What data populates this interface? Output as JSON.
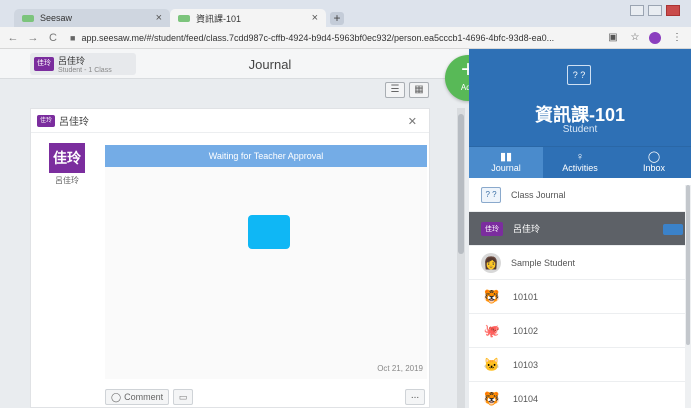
{
  "browser": {
    "tabs": [
      {
        "label": "Seesaw",
        "close": "×"
      },
      {
        "label": "資訊課-101",
        "close": "×"
      }
    ],
    "new_tab": "+",
    "url": "app.seesaw.me/#/student/feed/class.7cdd987c-cffb-4924-b9d4-5963bf0ec932/person.ea5cccb1-4696-4bfc-93d8-ea0..."
  },
  "topbar": {
    "user_name": "呂佳玲",
    "user_sub": "Student - 1 Class",
    "avatar_text": "佳玲",
    "page_title": "Journal"
  },
  "add_button": {
    "label": "Add"
  },
  "card": {
    "header_name": "呂佳玲",
    "avatar_text": "佳玲",
    "author_name": "呂佳玲",
    "approval_text": "Waiting for Teacher Approval",
    "date": "Oct 21, 2019",
    "comment_label": "Comment",
    "more_label": "..."
  },
  "right_panel": {
    "class_icon": "? ?",
    "class_name": "資訊課-101",
    "role": "Student",
    "tabs": [
      {
        "label": "Journal",
        "icon": "book-icon"
      },
      {
        "label": "Activities",
        "icon": "lightbulb-icon"
      },
      {
        "label": "Inbox",
        "icon": "chat-icon"
      }
    ],
    "list": [
      {
        "label": "Class Journal",
        "type": "journal",
        "icon_text": "? ?"
      },
      {
        "label": "呂佳玲",
        "type": "student",
        "icon_text": "佳玲"
      },
      {
        "label": "Sample Student",
        "type": "face",
        "icon_text": "👩"
      },
      {
        "label": "10101",
        "type": "face",
        "icon_text": "🐯"
      },
      {
        "label": "10102",
        "type": "face",
        "icon_text": "🐙"
      },
      {
        "label": "10103",
        "type": "face",
        "icon_text": "🐱"
      },
      {
        "label": "10104",
        "type": "face",
        "icon_text": "🐯"
      }
    ]
  },
  "colors": {
    "accent_blue": "#2e70b5",
    "add_green": "#58b957",
    "student_purple": "#7b2d9e",
    "approval_blue": "#74ace6",
    "selected_row": "#5d6167"
  }
}
